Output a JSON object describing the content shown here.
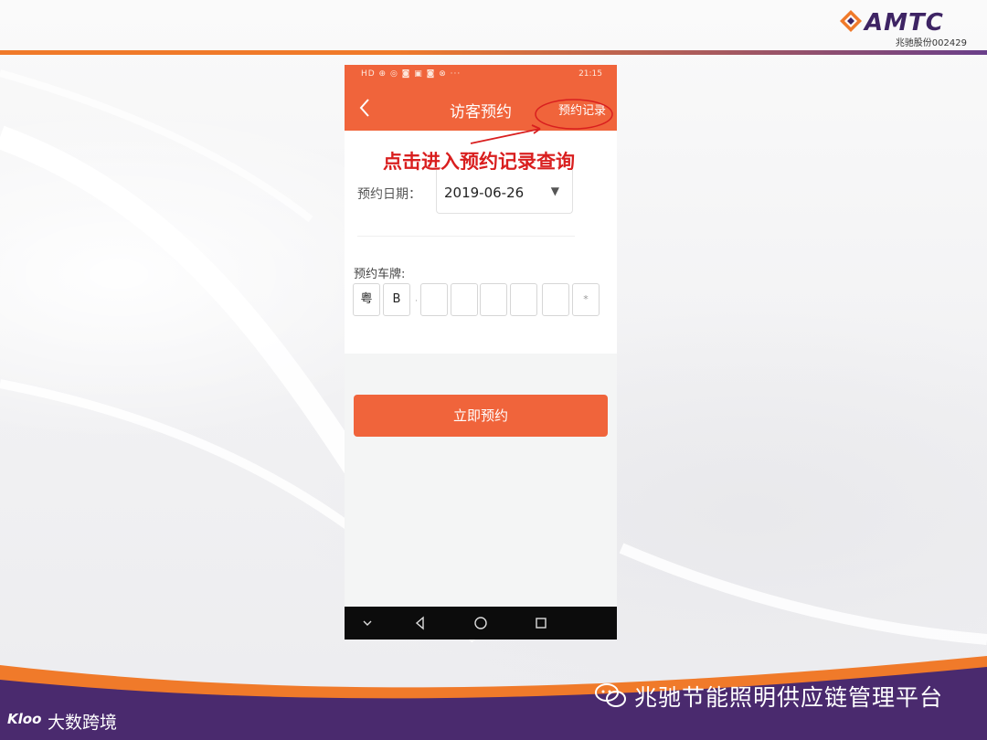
{
  "brand": {
    "name": "AMTC",
    "subtitle": "兆驰股份002429"
  },
  "phone": {
    "statusbar": {
      "left": "HD ⊕ ◎ ◙ ▣ ◙ ⊗ ···",
      "time": "21:15"
    },
    "appbar": {
      "title": "访客预约",
      "records_label": "预约记录"
    },
    "annotation": "点击进入预约记录查询",
    "form": {
      "date_label": "预约日期：",
      "date_value": "2019-06-26",
      "plate_label": "预约车牌:",
      "plate_chars": [
        "粤",
        "B",
        "",
        "",
        "",
        "",
        "",
        "*"
      ],
      "separator": "·"
    },
    "submit_label": "立即预约"
  },
  "footer": {
    "title": "兆驰节能照明供应链管理平台",
    "watermark": "大数跨境",
    "watermark_logo": "Kloo"
  },
  "colors": {
    "accent": "#f0643b",
    "brand_purple": "#3e2464",
    "annotation_red": "#d91f1f"
  }
}
